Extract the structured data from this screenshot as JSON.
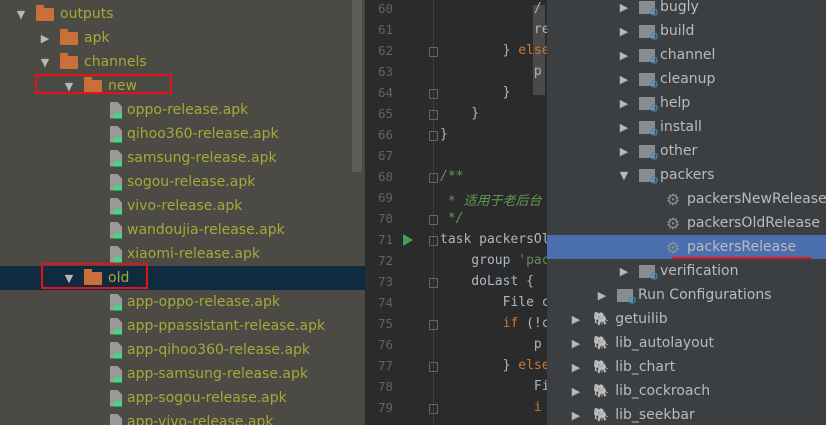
{
  "project_tree": {
    "items": [
      {
        "label": "outputs",
        "type": "folder",
        "depth": 0,
        "expanded": true
      },
      {
        "label": "apk",
        "type": "folder",
        "depth": 1,
        "expanded": false
      },
      {
        "label": "channels",
        "type": "folder",
        "depth": 1,
        "expanded": true
      },
      {
        "label": "new",
        "type": "folder",
        "depth": 2,
        "expanded": true,
        "highlighted": true
      },
      {
        "label": "oppo-release.apk",
        "type": "apk",
        "depth": 3
      },
      {
        "label": "qihoo360-release.apk",
        "type": "apk",
        "depth": 3
      },
      {
        "label": "samsung-release.apk",
        "type": "apk",
        "depth": 3
      },
      {
        "label": "sogou-release.apk",
        "type": "apk",
        "depth": 3
      },
      {
        "label": "vivo-release.apk",
        "type": "apk",
        "depth": 3
      },
      {
        "label": "wandoujia-release.apk",
        "type": "apk",
        "depth": 3
      },
      {
        "label": "xiaomi-release.apk",
        "type": "apk",
        "depth": 3
      },
      {
        "label": "old",
        "type": "folder",
        "depth": 2,
        "expanded": true,
        "highlighted": true,
        "selected": true
      },
      {
        "label": "app-oppo-release.apk",
        "type": "apk",
        "depth": 3
      },
      {
        "label": "app-ppassistant-release.apk",
        "type": "apk",
        "depth": 3
      },
      {
        "label": "app-qihoo360-release.apk",
        "type": "apk",
        "depth": 3
      },
      {
        "label": "app-samsung-release.apk",
        "type": "apk",
        "depth": 3
      },
      {
        "label": "app-sogou-release.apk",
        "type": "apk",
        "depth": 3
      },
      {
        "label": "app-vivo-release.apk",
        "type": "apk",
        "depth": 3
      }
    ]
  },
  "editor": {
    "lines": [
      {
        "n": "60",
        "html": "            <span>/</span>"
      },
      {
        "n": "61",
        "html": "            re"
      },
      {
        "n": "62",
        "html": "        } <span class='kw'>else</span>",
        "fold": true
      },
      {
        "n": "63",
        "html": "            p"
      },
      {
        "n": "64",
        "html": "        }",
        "fold": true
      },
      {
        "n": "65",
        "html": "    }",
        "fold": true
      },
      {
        "n": "66",
        "html": "}",
        "fold": true
      },
      {
        "n": "67",
        "html": ""
      },
      {
        "n": "68",
        "html": "<span class='cm'>/**</span>",
        "fold": true
      },
      {
        "n": "69",
        "html": "<span class='cm'> * 适用于老后台</span>"
      },
      {
        "n": "70",
        "html": "<span class='cm'> */</span>",
        "fold": true
      },
      {
        "n": "71",
        "html": "task packersOl",
        "fold": true,
        "run": true
      },
      {
        "n": "72",
        "html": "    group <span class='str'>'pac</span>"
      },
      {
        "n": "73",
        "html": "    doLast {",
        "fold": true
      },
      {
        "n": "74",
        "html": "        File c"
      },
      {
        "n": "75",
        "html": "        <span class='kw'>if</span> (!c",
        "fold": true
      },
      {
        "n": "76",
        "html": "            p"
      },
      {
        "n": "77",
        "html": "        } <span class='kw'>else</span>",
        "fold": true
      },
      {
        "n": "78",
        "html": "            Fi"
      },
      {
        "n": "79",
        "html": "            <span class='kw'>i</span>",
        "fold": true
      }
    ]
  },
  "gradle_tree": {
    "items": [
      {
        "label": "bugly",
        "type": "group",
        "depth": 2
      },
      {
        "label": "build",
        "type": "group",
        "depth": 2
      },
      {
        "label": "channel",
        "type": "group",
        "depth": 2
      },
      {
        "label": "cleanup",
        "type": "group",
        "depth": 2
      },
      {
        "label": "help",
        "type": "group",
        "depth": 2
      },
      {
        "label": "install",
        "type": "group",
        "depth": 2
      },
      {
        "label": "other",
        "type": "group",
        "depth": 2
      },
      {
        "label": "packers",
        "type": "group",
        "depth": 2,
        "expanded": true
      },
      {
        "label": "packersNewRelease",
        "type": "task",
        "depth": 3
      },
      {
        "label": "packersOldRelease",
        "type": "task",
        "depth": 3
      },
      {
        "label": "packersRelease",
        "type": "task",
        "depth": 3,
        "selected": true
      },
      {
        "label": "verification",
        "type": "group",
        "depth": 2
      },
      {
        "label": "Run Configurations",
        "type": "group",
        "depth": 1
      },
      {
        "label": "getuilib",
        "type": "module",
        "depth": 0
      },
      {
        "label": "lib_autolayout",
        "type": "module",
        "depth": 0
      },
      {
        "label": "lib_chart",
        "type": "module",
        "depth": 0
      },
      {
        "label": "lib_cockroach",
        "type": "module",
        "depth": 0
      },
      {
        "label": "lib_seekbar",
        "type": "module",
        "depth": 0
      }
    ]
  },
  "colors": {
    "selection_blue": "#4b6eaf",
    "highlight_red": "#e8101a",
    "file_text": "#a8a839"
  }
}
